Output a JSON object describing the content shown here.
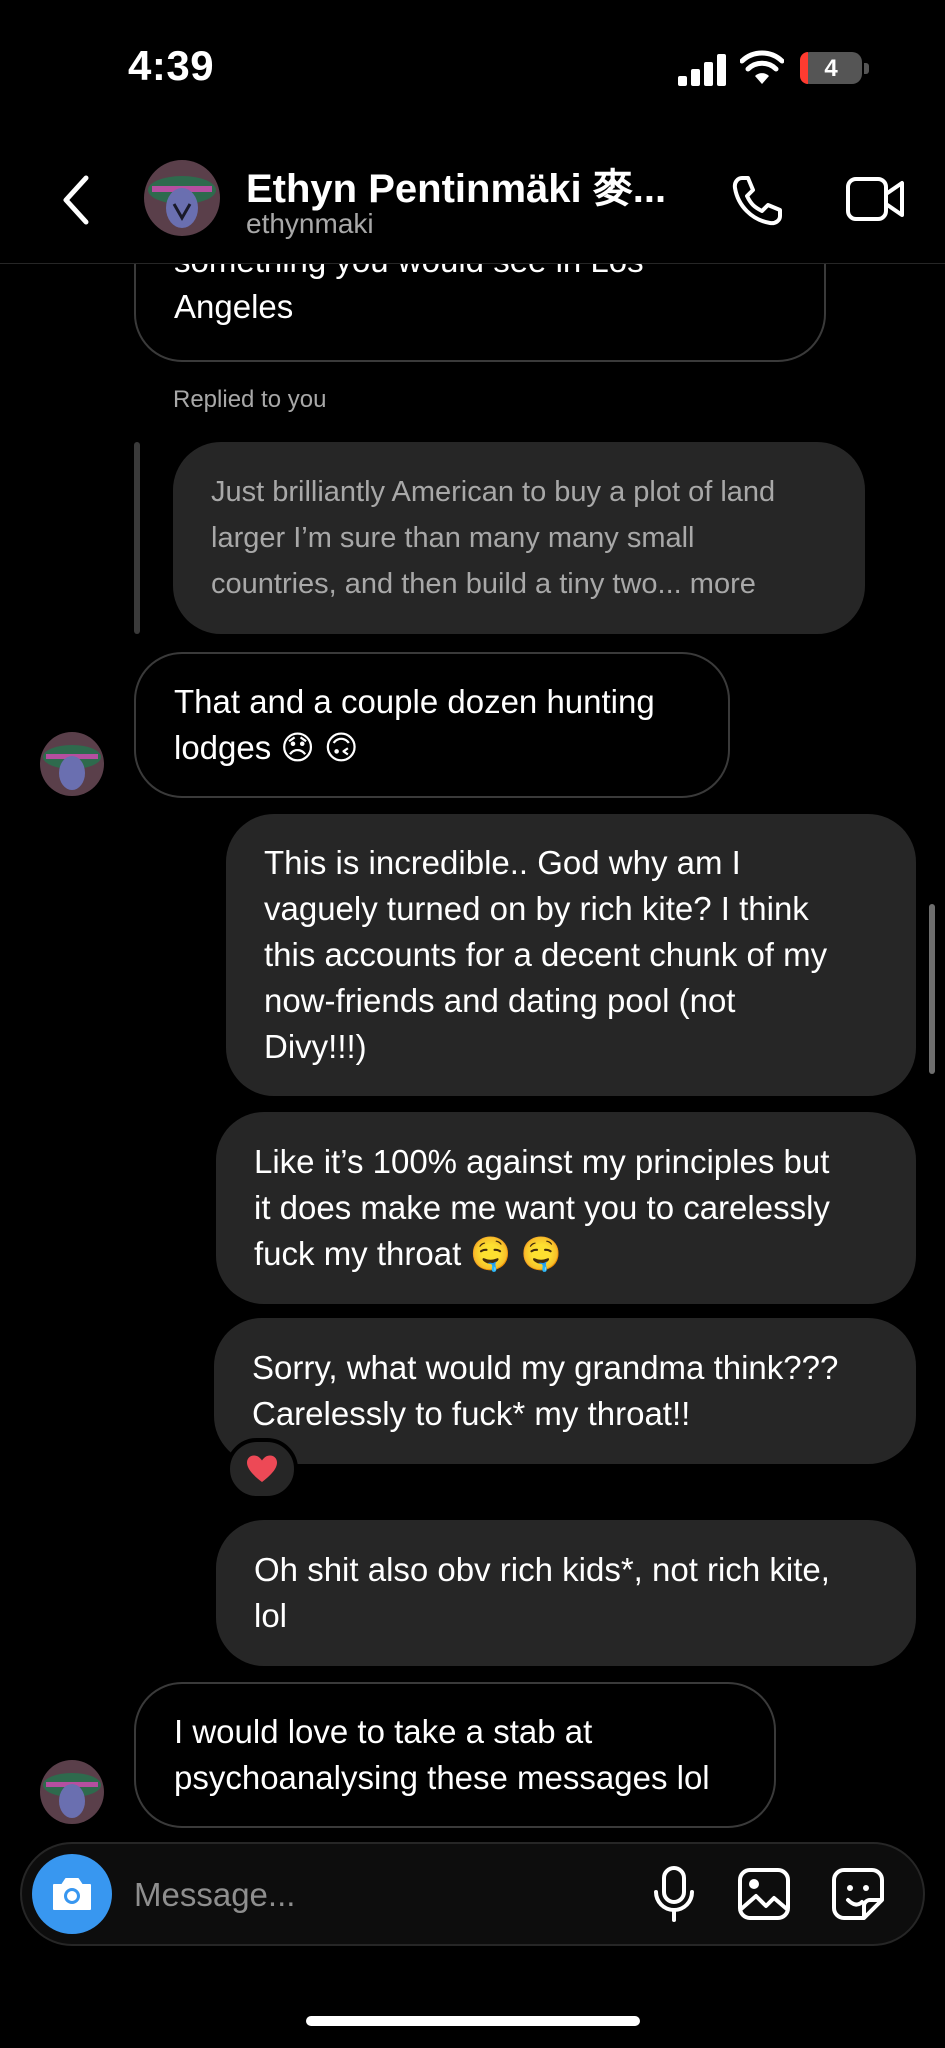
{
  "status_bar": {
    "time": "4:39",
    "battery": "4"
  },
  "header": {
    "contact_name": "Ethyn Pentinmäki 麥...",
    "contact_handle": "ethynmaki"
  },
  "messages": {
    "m0": {
      "text_line1": "something you would see in Los",
      "text_line2": "Angeles"
    },
    "replied_label": "Replied to you",
    "reply_quote": {
      "line1": "Just brilliantly American to buy a plot of land",
      "line2": "larger I’m sure than many many small",
      "line3": "countries, and then build a tiny two... more"
    },
    "m1": {
      "line1": "That and a couple dozen hunting",
      "line2": "lodges 😞 🙃"
    },
    "m2": {
      "line1": "This is incredible.. God why am I",
      "line2": "vaguely turned on by rich kite? I think",
      "line3": "this accounts for a decent chunk of my",
      "line4": "now-friends and dating pool (not",
      "line5": "Divy!!!)"
    },
    "m3": {
      "line1": "Like it’s 100% against my principles but",
      "line2": "it does make me want you to carelessly",
      "line3": "fuck my throat 🤤 🤤"
    },
    "m4": {
      "line1": "Sorry, what would my grandma think???",
      "line2": "Carelessly to fuck* my throat!!",
      "reaction": "❤️"
    },
    "m5": {
      "line1": "Oh shit also obv rich kids*, not rich kite,",
      "line2": "lol"
    },
    "m6": {
      "line1": "I would love to take a stab at",
      "line2": "psychoanalysing these messages lol"
    }
  },
  "composer": {
    "placeholder": "Message..."
  },
  "colors": {
    "accent_blue": "#3897f0",
    "bubble_out": "#262626",
    "background": "#000000"
  }
}
